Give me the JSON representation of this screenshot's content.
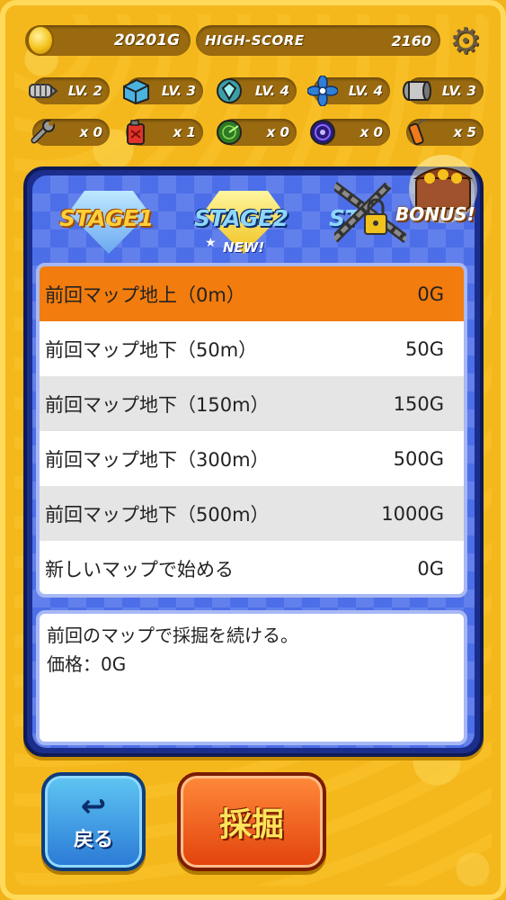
{
  "header": {
    "gold": "20201G",
    "high_score_label": "HIGH-SCORE",
    "high_score": "2160",
    "settings_icon": "gear-icon"
  },
  "levels": [
    {
      "icon": "drill-icon",
      "label": "LV. 2"
    },
    {
      "icon": "crate-icon",
      "label": "LV. 3"
    },
    {
      "icon": "diamond-shield-icon",
      "label": "LV. 4"
    },
    {
      "icon": "fan-icon",
      "label": "LV. 4"
    },
    {
      "icon": "roller-icon",
      "label": "LV. 3"
    }
  ],
  "items": [
    {
      "icon": "wrench-icon",
      "label": "x 0"
    },
    {
      "icon": "fuel-can-icon",
      "label": "x 1"
    },
    {
      "icon": "radar-icon",
      "label": "x 0"
    },
    {
      "icon": "vortex-icon",
      "label": "x 0"
    },
    {
      "icon": "dynamite-icon",
      "label": "x 5"
    }
  ],
  "stages": {
    "stage1": "STAGE1",
    "stage2": "STAGE2",
    "stage3_partial": "ST",
    "new_badge": "NEW!",
    "bonus": "BONUS!"
  },
  "options": [
    {
      "label": "前回マップ地上（0m）",
      "price": "0G",
      "selected": true
    },
    {
      "label": "前回マップ地下（50m）",
      "price": "50G",
      "selected": false
    },
    {
      "label": "前回マップ地下（150m）",
      "price": "150G",
      "selected": false
    },
    {
      "label": "前回マップ地下（300m）",
      "price": "500G",
      "selected": false
    },
    {
      "label": "前回マップ地下（500m）",
      "price": "1000G",
      "selected": false
    },
    {
      "label": "新しいマップで始める",
      "price": "0G",
      "selected": false
    }
  ],
  "description": {
    "line1": "前回のマップで採掘を続ける。",
    "line2": "価格：0G"
  },
  "buttons": {
    "back": "戻る",
    "dig": "採掘"
  },
  "colors": {
    "selected_row": "#f27c0d",
    "panel_blue": "#4c6ee8",
    "frame_yellow": "#f4b81d"
  }
}
